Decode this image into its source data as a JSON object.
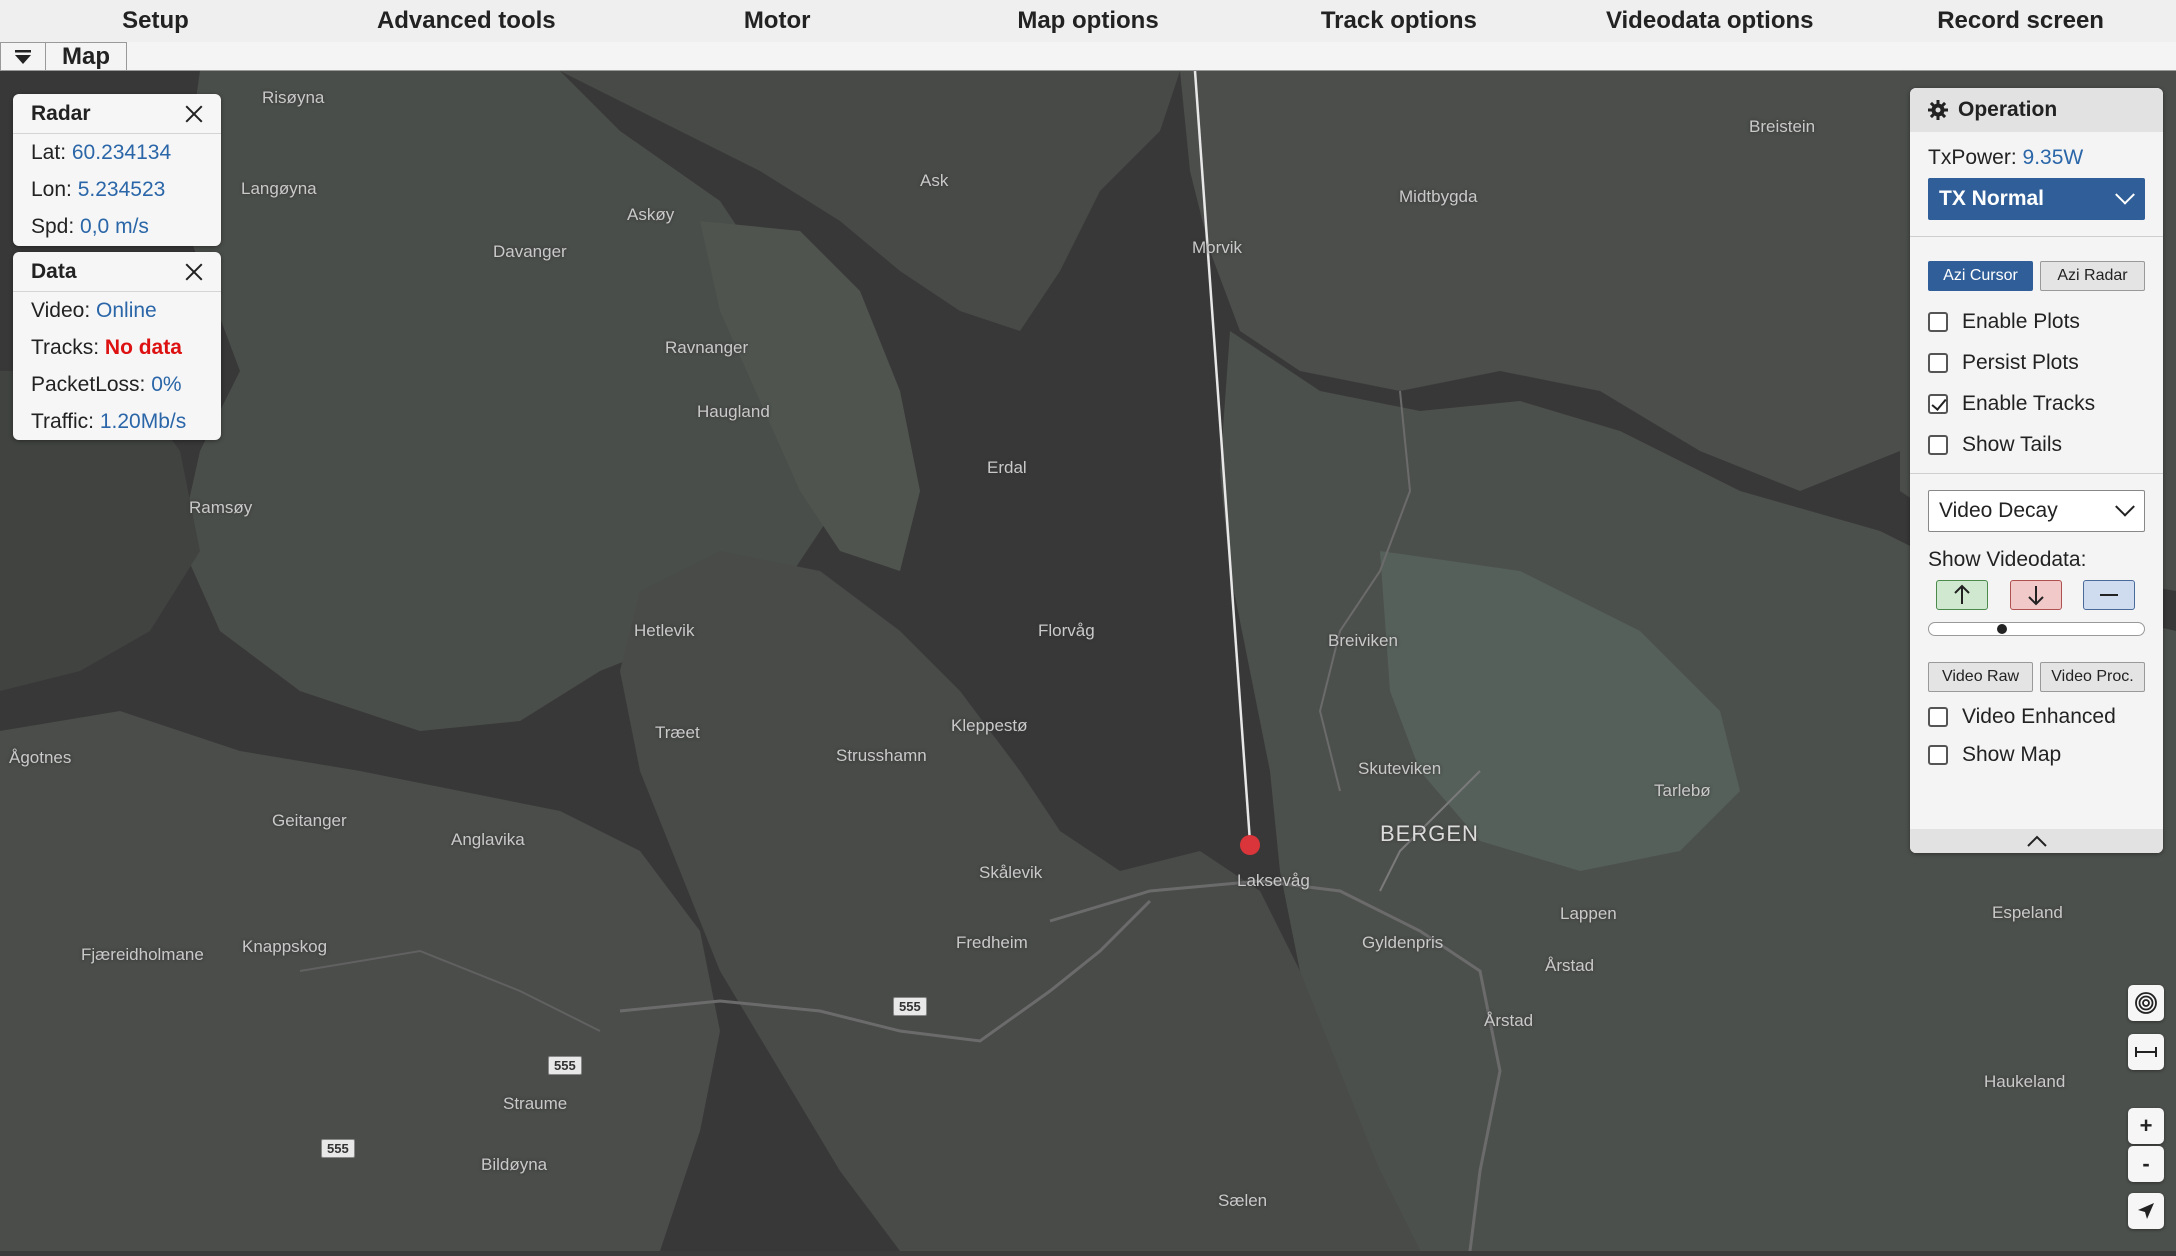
{
  "menu": [
    "Setup",
    "Advanced tools",
    "Motor",
    "Map options",
    "Track options",
    "Videodata options",
    "Record screen"
  ],
  "tabs": {
    "active_label": "Map"
  },
  "radar_panel": {
    "title": "Radar",
    "lat_label": "Lat:",
    "lat_value": "60.234134",
    "lon_label": "Lon:",
    "lon_value": "5.234523",
    "spd_label": "Spd:",
    "spd_value": "0,0 m/s"
  },
  "data_panel": {
    "title": "Data",
    "video_label": "Video:",
    "video_value": "Online",
    "tracks_label": "Tracks:",
    "tracks_value": "No data",
    "packetloss_label": "PacketLoss:",
    "packetloss_value": "0%",
    "traffic_label": "Traffic:",
    "traffic_value": "1.20Mb/s"
  },
  "operation": {
    "title": "Operation",
    "txpower_label": "TxPower:",
    "txpower_value": "9.35W",
    "tx_mode": "TX Normal",
    "azi_cursor": "Azi Cursor",
    "azi_radar": "Azi Radar",
    "enable_plots": "Enable Plots",
    "persist_plots": "Persist Plots",
    "enable_tracks": "Enable Tracks",
    "show_tails": "Show Tails",
    "video_decay": "Video Decay",
    "show_videodata": "Show Videodata:",
    "video_raw": "Video Raw",
    "video_proc": "Video Proc.",
    "video_enhanced": "Video Enhanced",
    "show_map": "Show Map",
    "checked": {
      "enable_plots": false,
      "persist_plots": false,
      "enable_tracks": true,
      "show_tails": false,
      "video_enhanced": false,
      "show_map": false
    },
    "slider_fraction": 0.33
  },
  "map_labels": {
    "bergen": "BERGEN",
    "laksevag": "Laksevåg",
    "skuteviken": "Skuteviken",
    "breiviken": "Breiviken",
    "tarlebo": "Tarlebø",
    "lappen": "Lappen",
    "arstad": "Årstad",
    "arstad2": "Årstad",
    "gyldenpris": "Gyldenpris",
    "espeland": "Espeland",
    "haukeland": "Haukeland",
    "saelen": "Sælen",
    "fredheim": "Fredheim",
    "skalevik": "Skålevik",
    "kleppesto": "Kleppestø",
    "strusshamn": "Strusshamn",
    "florvag": "Florvåg",
    "erdal": "Erdal",
    "haugland": "Haugland",
    "ravnanger": "Ravnanger",
    "davanger": "Davanger",
    "askoy": "Askøy",
    "ask": "Ask",
    "morvik": "Morvik",
    "midtbygda": "Midtbygda",
    "breistein": "Breistein",
    "risoyna": "Risøyna",
    "langoyna": "Langøyna",
    "ramsoy": "Ramsøy",
    "hetlevik": "Hetlevik",
    "traeet": "Træet",
    "agotnes": "Ågotnes",
    "geitanger": "Geitanger",
    "anglavika": "Anglavika",
    "fjaereidholmane": "Fjæreidholmane",
    "knappskog": "Knappskog",
    "straume": "Straume",
    "bildoyna": "Bildøyna",
    "road_555": "555"
  },
  "colors": {
    "accent": "#2f5e98",
    "value_blue": "#2a66a8",
    "alert_red": "#dd1111",
    "radar_dot": "#d9353a"
  },
  "icons": {
    "tab_toggle": "triangle-down-icon",
    "op_head": "gear-icon",
    "ctrl_1": "target-rings-icon",
    "ctrl_2": "measure-icon",
    "ctrl_3": "zoom-in-icon",
    "ctrl_4": "zoom-out-icon",
    "ctrl_5": "locate-arrow-icon"
  },
  "controls": {
    "zoom_in": "+",
    "zoom_out": "-"
  }
}
